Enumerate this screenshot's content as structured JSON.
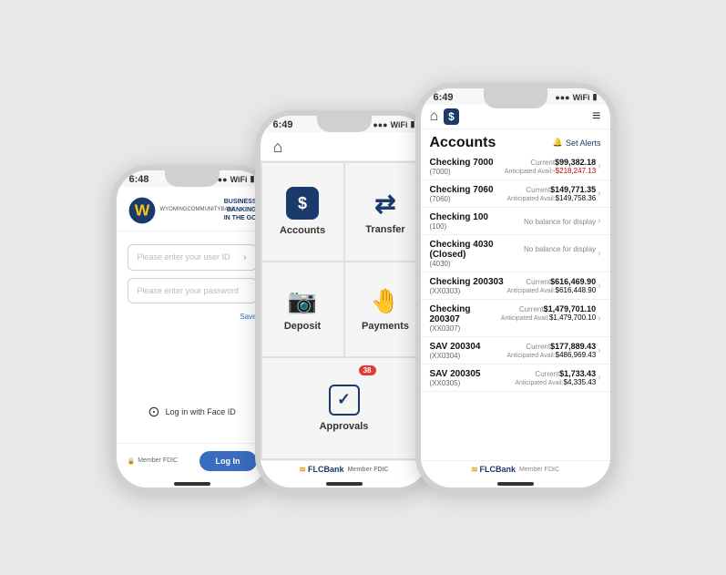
{
  "phone1": {
    "status": {
      "time": "6:48",
      "icons": [
        "●●●",
        "WiFi",
        "🔋"
      ]
    },
    "logo": {
      "letter": "W",
      "tagline_line1": "BUSINESS",
      "tagline_line2": "BANKING",
      "tagline_line3": "IN THE GO"
    },
    "username_placeholder": "Please enter your user ID",
    "password_placeholder": "Please enter your password",
    "face_id_label": "Log in with Face ID",
    "login_button": "Log In",
    "fdic_label": "Member FDIC"
  },
  "phone2": {
    "status": {
      "time": "6:49",
      "icons": [
        "●●●",
        "WiFi",
        "🔋"
      ]
    },
    "menu_items": [
      {
        "id": "accounts",
        "label": "Accounts",
        "icon": "$"
      },
      {
        "id": "transfer",
        "label": "Transfer",
        "icon": "⇄"
      },
      {
        "id": "deposit",
        "label": "Deposit",
        "icon": "📷"
      },
      {
        "id": "payments",
        "label": "Payments",
        "icon": "💰"
      },
      {
        "id": "approvals",
        "label": "Approvals",
        "icon": "✓",
        "badge": "38"
      }
    ],
    "footer": "FLCBank",
    "member_fdic": "Member FDIC"
  },
  "phone3": {
    "status": {
      "time": "6:49",
      "icons": [
        "●●●",
        "WiFi",
        "🔋"
      ]
    },
    "title": "Accounts",
    "set_alerts": "Set Alerts",
    "accounts": [
      {
        "name": "Checking 7000",
        "num": "(7000)",
        "current_label": "Current",
        "current": "$99,382.18",
        "anticipated_label": "Anticipated Avail:",
        "anticipated": "-$218,247.13",
        "anticipated_negative": true
      },
      {
        "name": "Checking 7060",
        "num": "(7060)",
        "current_label": "Current",
        "current": "$149,771.35",
        "anticipated_label": "Anticipated Avail:",
        "anticipated": "$149,758.36",
        "anticipated_negative": false
      },
      {
        "name": "Checking 100",
        "num": "(100)",
        "no_balance": "No balance for display"
      },
      {
        "name": "Checking 4030 (Closed)",
        "num": "(4030)",
        "no_balance": "No balance for display"
      },
      {
        "name": "Checking 200303",
        "num": "(XX0303)",
        "current_label": "Current",
        "current": "$616,469.90",
        "anticipated_label": "Anticipated Avail:",
        "anticipated": "$616,448.90",
        "anticipated_negative": false
      },
      {
        "name": "Checking 200307",
        "num": "(XX0307)",
        "current_label": "Current",
        "current": "$1,479,701.10",
        "anticipated_label": "Anticipated Avail:",
        "anticipated": "$1,479,700.10",
        "anticipated_negative": false
      },
      {
        "name": "SAV 200304",
        "num": "(XX0304)",
        "current_label": "Current",
        "current": "$177,889.43",
        "anticipated_label": "Anticipated Avail:",
        "anticipated": "$486,969.43",
        "anticipated_negative": false
      },
      {
        "name": "SAV 200305",
        "num": "(XX0305)",
        "current_label": "Current",
        "current": "$1,733.43",
        "anticipated_label": "Anticipated Avail:",
        "anticipated": "$4,335.43",
        "anticipated_negative": false
      }
    ],
    "footer": "FLCBank",
    "member_fdic": "Member FDIC"
  }
}
